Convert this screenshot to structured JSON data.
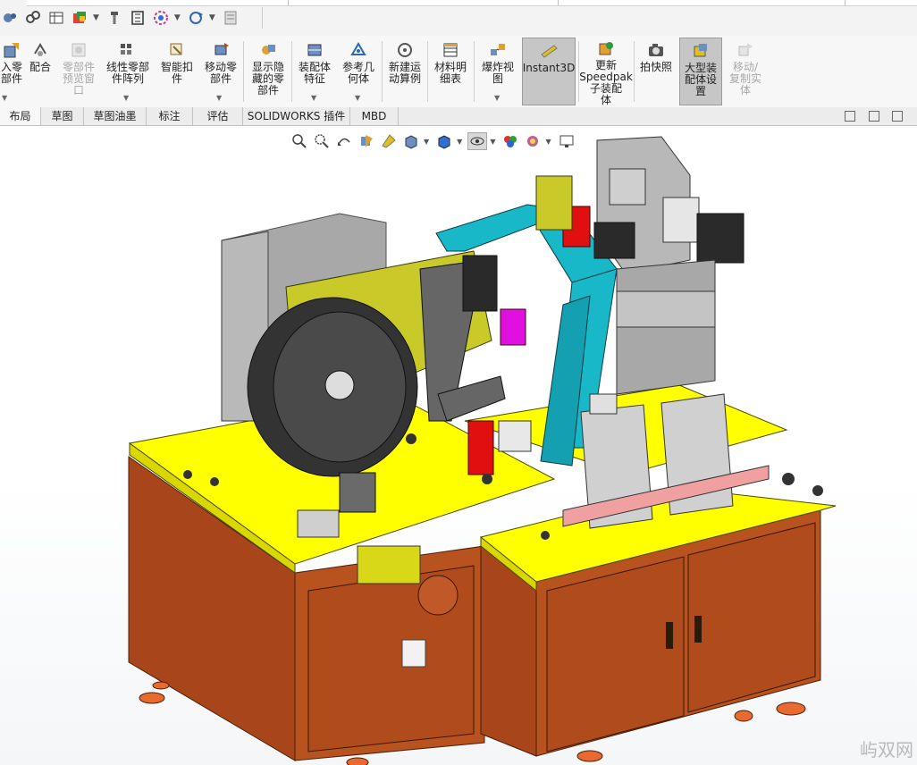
{
  "quick_access": {
    "icons": [
      "assembly-tools-icon",
      "gear-link-icon",
      "component-table-icon",
      "rebuild-icon",
      "screw-icon",
      "measure-icon",
      "appearance-icon",
      "rotate-options-icon",
      "file-properties-icon"
    ]
  },
  "ribbon": {
    "buttons": [
      {
        "label": "入零\n部件",
        "icon": "insert-component-icon",
        "disabled": false,
        "dropdown": true
      },
      {
        "label": "配合",
        "icon": "mate-icon",
        "disabled": false,
        "dropdown": false
      },
      {
        "label": "零部件\n预览窗\n口",
        "icon": "component-preview-icon",
        "disabled": true,
        "dropdown": false
      },
      {
        "label": "线性零部\n件阵列",
        "icon": "linear-pattern-icon",
        "disabled": false,
        "dropdown": true
      },
      {
        "label": "智能扣\n件",
        "icon": "smart-fastener-icon",
        "disabled": false,
        "dropdown": false
      },
      {
        "label": "移动零\n部件",
        "icon": "move-component-icon",
        "disabled": false,
        "dropdown": true
      },
      {
        "label": "显示隐\n藏的零\n部件",
        "icon": "show-hidden-icon",
        "disabled": false,
        "dropdown": false
      },
      {
        "label": "装配体\n特征",
        "icon": "assembly-feature-icon",
        "disabled": false,
        "dropdown": true
      },
      {
        "label": "参考几\n何体",
        "icon": "reference-geometry-icon",
        "disabled": false,
        "dropdown": true
      },
      {
        "label": "新建运\n动算例",
        "icon": "motion-study-icon",
        "disabled": false,
        "dropdown": false
      },
      {
        "label": "材料明\n细表",
        "icon": "bom-icon",
        "disabled": false,
        "dropdown": false
      },
      {
        "label": "爆炸视\n图",
        "icon": "exploded-view-icon",
        "disabled": false,
        "dropdown": true
      },
      {
        "label": "Instant3D",
        "icon": "instant3d-icon",
        "disabled": false,
        "dropdown": false,
        "active": true
      },
      {
        "label": "更新\nSpeedpak\n子装配\n体",
        "icon": "speedpak-icon",
        "disabled": false,
        "dropdown": false
      },
      {
        "label": "拍快照",
        "icon": "snapshot-icon",
        "disabled": false,
        "dropdown": false
      },
      {
        "label": "大型装\n配体设\n置",
        "icon": "large-assembly-icon",
        "disabled": false,
        "dropdown": false,
        "active": true
      },
      {
        "label": "移动/\n复制实\n体",
        "icon": "move-copy-body-icon",
        "disabled": true,
        "dropdown": false
      }
    ]
  },
  "tabs": [
    "布局",
    "草图",
    "草图油墨",
    "标注",
    "评估",
    "SOLIDWORKS 插件",
    "MBD"
  ],
  "heads_up": {
    "icons": [
      "zoom-to-fit-icon",
      "zoom-area-icon",
      "previous-view-icon",
      "section-view-icon",
      "dynamic-annotation-icon",
      "view-orientation-icon",
      "display-style-icon",
      "hide-show-icon",
      "edit-appearance-icon",
      "apply-scene-icon",
      "view-settings-icon"
    ]
  },
  "watermark": "屿双网",
  "colors": {
    "cabinet": "#b8521f",
    "table_top": "#ffff00",
    "frame_cyan": "#18b8c8",
    "plate_olive": "#c9c92a",
    "panel_gray": "#8f8f8f",
    "motor_black": "#2a2a2a"
  }
}
